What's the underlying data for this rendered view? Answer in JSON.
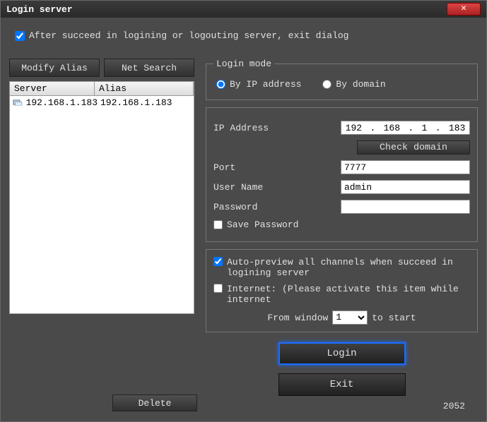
{
  "title": "Login server",
  "exitDialog": {
    "label": "After succeed in logining or logouting server, exit dialog",
    "checked": true
  },
  "buttons": {
    "modifyAlias": "Modify Alias",
    "netSearch": "Net Search",
    "delete": "Delete",
    "checkDomain": "Check domain",
    "login": "Login",
    "exit": "Exit"
  },
  "table": {
    "headers": {
      "server": "Server",
      "alias": "Alias"
    },
    "rows": [
      {
        "server": "192.168.1.183",
        "alias": "192.168.1.183"
      }
    ]
  },
  "loginMode": {
    "legend": "Login mode",
    "byIp": "By IP address",
    "byDomain": "By domain",
    "selected": "ip"
  },
  "form": {
    "ipLabel": "IP Address",
    "ip": {
      "o1": "192",
      "o2": "168",
      "o3": "1",
      "o4": "183",
      "dot": "."
    },
    "portLabel": "Port",
    "port": "7777",
    "userLabel": "User Name",
    "user": "admin",
    "passLabel": "Password",
    "pass": "",
    "savePassLabel": "Save Password",
    "savePassChecked": false
  },
  "options": {
    "autoPreview": {
      "label": "Auto-preview all channels when succeed in logining server",
      "checked": true
    },
    "internet": {
      "label": "Internet: (Please activate this item while internet",
      "checked": false
    },
    "fromWindow": {
      "pre": "From window",
      "post": "to start",
      "value": "1"
    }
  },
  "status": "2052"
}
